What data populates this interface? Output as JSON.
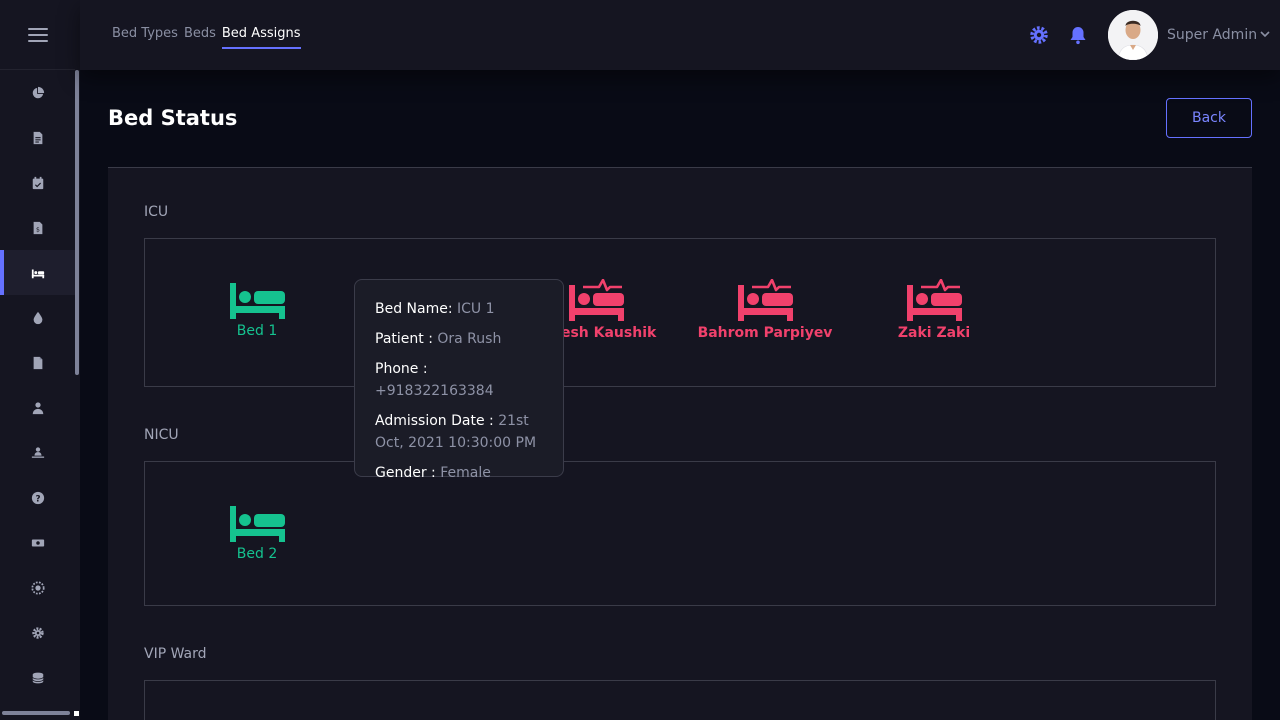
{
  "colors": {
    "accent": "#6571ff",
    "free": "#15c28f",
    "occupied": "#f1416c",
    "bg": "#090b16",
    "panel": "#151521"
  },
  "breadcrumbs": [
    {
      "label": "Bed Types",
      "active": false
    },
    {
      "label": "Beds",
      "active": false
    },
    {
      "label": "Bed Assigns",
      "active": true
    }
  ],
  "header": {
    "user_name": "Super Admin",
    "icons": [
      "gear-icon",
      "bell-icon",
      "avatar",
      "chevron-down-icon"
    ]
  },
  "sidebar": {
    "items": [
      {
        "icon": "chart-pie-icon"
      },
      {
        "icon": "file-list-icon"
      },
      {
        "icon": "calendar-check-icon"
      },
      {
        "icon": "file-invoice-icon"
      },
      {
        "icon": "bed-icon",
        "active": true
      },
      {
        "icon": "blood-drop-icon"
      },
      {
        "icon": "document-icon"
      },
      {
        "icon": "doctor-icon"
      },
      {
        "icon": "users-icon"
      },
      {
        "icon": "question-icon"
      },
      {
        "icon": "money-icon"
      },
      {
        "icon": "dna-icon"
      },
      {
        "icon": "gear-icon"
      },
      {
        "icon": "coins-icon"
      }
    ]
  },
  "page": {
    "title": "Bed Status",
    "back_label": "Back"
  },
  "wards": [
    {
      "name": "ICU",
      "beds": [
        {
          "label": "Bed 1",
          "status": "free"
        },
        {
          "label": "hesh Kaushik",
          "status": "occupied"
        },
        {
          "label": "Bahrom Parpiyev",
          "status": "occupied"
        },
        {
          "label": "Zaki Zaki",
          "status": "occupied"
        }
      ]
    },
    {
      "name": "NICU",
      "beds": [
        {
          "label": "Bed 2",
          "status": "free"
        }
      ]
    },
    {
      "name": "VIP Ward",
      "beds": []
    }
  ],
  "tooltip": {
    "bed_name_key": "Bed Name:",
    "bed_name": "ICU 1",
    "patient_key": "Patient :",
    "patient": "Ora Rush",
    "phone_key": "Phone :",
    "phone": "+918322163384",
    "admission_key": "Admission Date :",
    "admission": "21st Oct, 2021 10:30:00 PM",
    "gender_key": "Gender :",
    "gender": "Female"
  }
}
